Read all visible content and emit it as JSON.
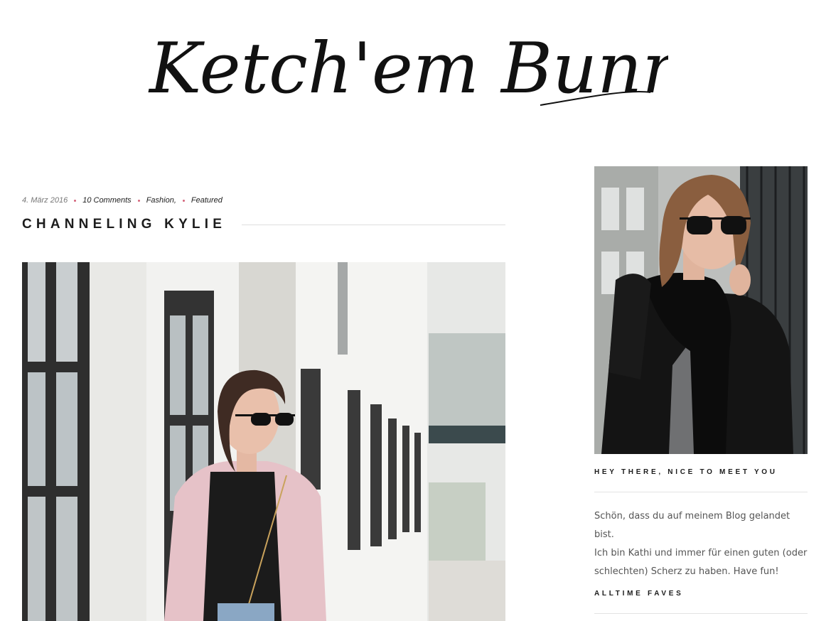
{
  "site": {
    "logo_text": "Ketch'em Bunnies"
  },
  "post": {
    "date": "4. März 2016",
    "comments": "10 Comments",
    "categories": [
      "Fashion,",
      "Featured"
    ],
    "title": "CHANNELING KYLIE"
  },
  "sidebar": {
    "about_title": "HEY THERE, NICE TO MEET YOU",
    "about_lines": [
      "Schön, dass du auf meinem Blog gelandet bist.",
      "Ich bin Kathi und immer für einen guten (oder",
      "schlechten) Scherz zu haben. Have fun!"
    ],
    "faves_title": "ALLTIME FAVES"
  },
  "colors": {
    "meta_dot": "#d4647a",
    "divider": "#dedede",
    "text": "#1c1c1c"
  }
}
